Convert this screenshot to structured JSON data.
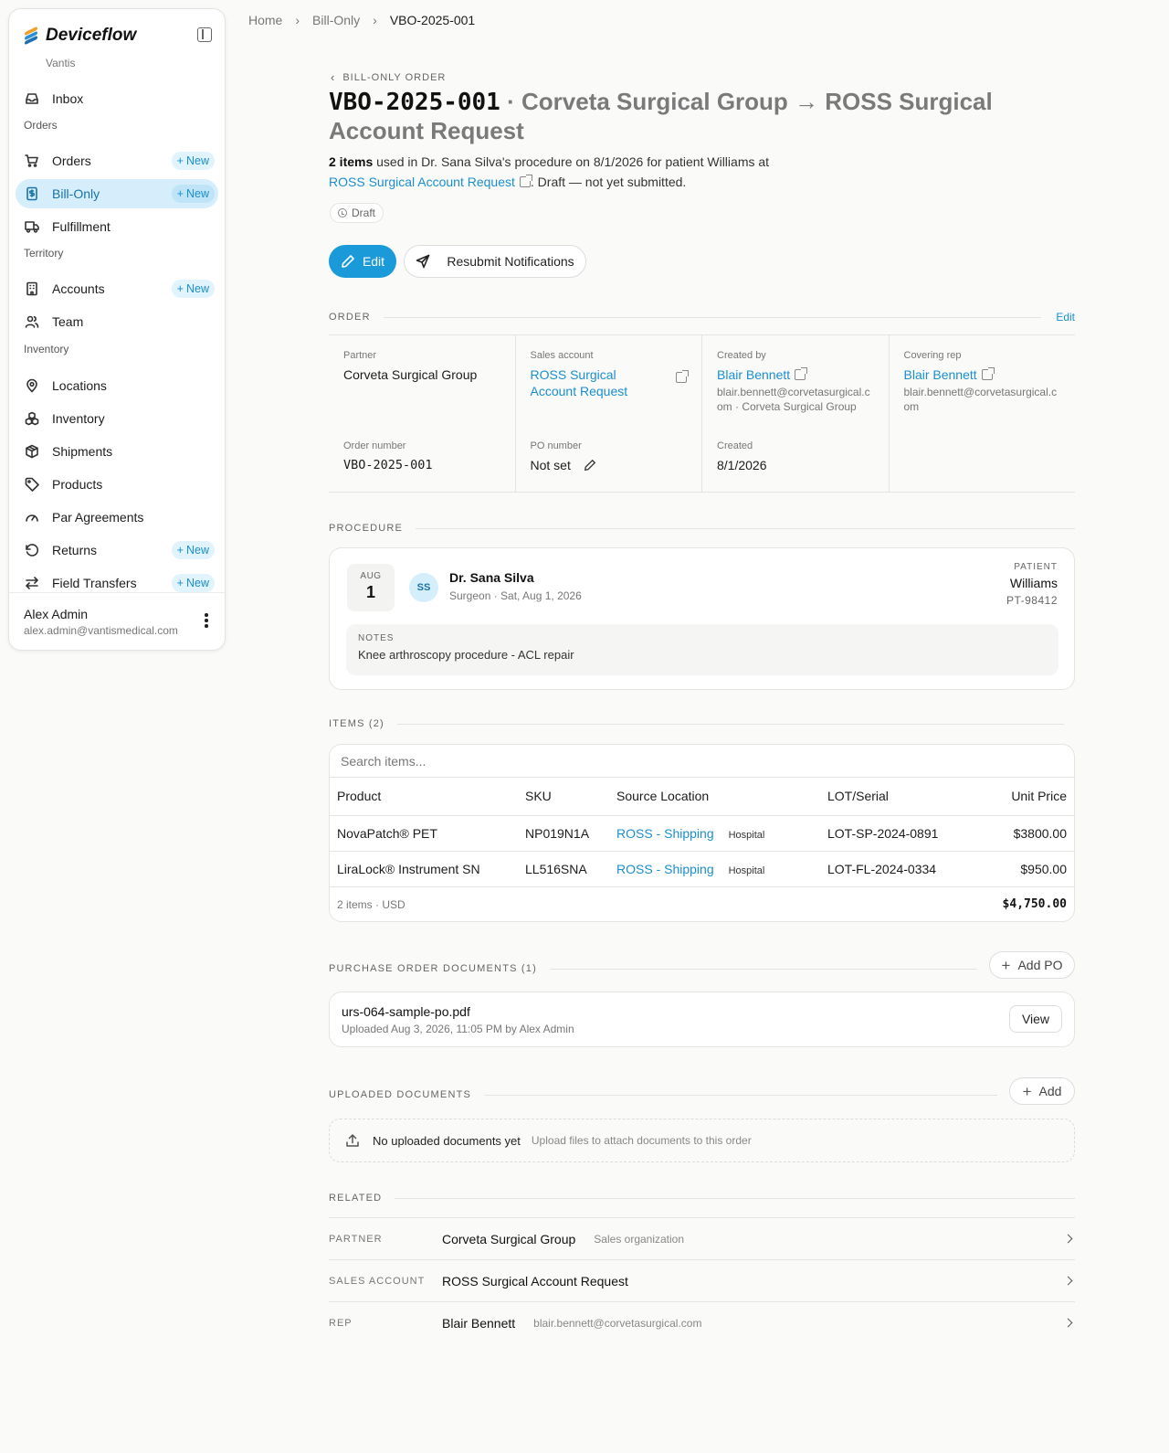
{
  "brand": {
    "name": "Deviceflow",
    "org": "Vantis"
  },
  "nav": {
    "inbox": "Inbox",
    "section_orders": "Orders",
    "orders": "Orders",
    "bill_only": "Bill-Only",
    "fulfillment": "Fulfillment",
    "section_territory": "Territory",
    "accounts": "Accounts",
    "team": "Team",
    "section_inventory": "Inventory",
    "locations": "Locations",
    "inventory": "Inventory",
    "shipments": "Shipments",
    "products": "Products",
    "par_agreements": "Par Agreements",
    "returns": "Returns",
    "field_transfers": "Field Transfers",
    "new_label": "New"
  },
  "user": {
    "name": "Alex Admin",
    "email": "alex.admin@vantismedical.com"
  },
  "breadcrumb": {
    "home": "Home",
    "section": "Bill-Only",
    "current": "VBO-2025-001"
  },
  "header": {
    "back_label": "BILL-ONLY ORDER",
    "order_code": "VBO-2025-001",
    "title_rest": "· Corveta Surgical Group → ROSS Surgical Account Request",
    "summary_count": "2 items",
    "summary_text": " used in Dr. Sana Silva's procedure on 8/1/2026 for patient Williams at",
    "summary_account": "ROSS Surgical Account Request",
    "summary_tail": ". Draft — not yet submitted.",
    "status": "Draft",
    "edit_button": "Edit",
    "resubmit_button": "Resubmit Notifications"
  },
  "order_section": {
    "heading": "ORDER",
    "edit_link": "Edit",
    "partner_label": "Partner",
    "partner_value": "Corveta Surgical Group",
    "sales_account_label": "Sales account",
    "sales_account_value": "ROSS Surgical Account Request",
    "created_by_label": "Created by",
    "created_by_value": "Blair Bennett",
    "created_by_sub": "blair.bennett@corvetasurgical.com · Corveta Surgical Group",
    "covering_rep_label": "Covering rep",
    "covering_rep_value": "Blair Bennett",
    "covering_rep_sub": "blair.bennett@corvetasurgical.com",
    "order_number_label": "Order number",
    "order_number_value": "VBO-2025-001",
    "po_number_label": "PO number",
    "po_number_value": "Not set",
    "created_label": "Created",
    "created_value": "8/1/2026"
  },
  "procedure": {
    "heading": "PROCEDURE",
    "month": "AUG",
    "day": "1",
    "initials": "SS",
    "surgeon": "Dr. Sana Silva",
    "surgeon_sub": "Surgeon · Sat, Aug 1, 2026",
    "patient_label": "PATIENT",
    "patient_name": "Williams",
    "patient_id": "PT-98412",
    "notes_label": "NOTES",
    "notes_text": "Knee arthroscopy procedure - ACL repair"
  },
  "items": {
    "heading": "ITEMS (2)",
    "search_placeholder": "Search items...",
    "columns": {
      "product": "Product",
      "sku": "SKU",
      "source": "Source Location",
      "lot": "LOT/Serial",
      "price": "Unit Price"
    },
    "rows": [
      {
        "product": "NovaPatch® PET",
        "sku": "NP019N1A",
        "source": "ROSS - Shipping",
        "tag": "Hospital",
        "lot": "LOT-SP-2024-0891",
        "price": "$3800.00"
      },
      {
        "product": "LiraLock® Instrument SN",
        "sku": "LL516SNA",
        "source": "ROSS - Shipping",
        "tag": "Hospital",
        "lot": "LOT-FL-2024-0334",
        "price": "$950.00"
      }
    ],
    "footer_count": "2 items · USD",
    "footer_total": "$4,750.00"
  },
  "po_docs": {
    "heading": "PURCHASE ORDER DOCUMENTS (1)",
    "add_button": "Add PO",
    "file_name": "urs-064-sample-po.pdf",
    "file_sub": "Uploaded Aug 3, 2026, 11:05 PM by Alex Admin",
    "view_button": "View"
  },
  "uploaded_docs": {
    "heading": "UPLOADED DOCUMENTS",
    "add_button": "Add",
    "empty_title": "No uploaded documents yet",
    "empty_sub": "Upload files to attach documents to this order"
  },
  "related": {
    "heading": "RELATED",
    "partner_key": "PARTNER",
    "partner_value": "Corveta Surgical Group",
    "partner_sub": "Sales organization",
    "account_key": "SALES ACCOUNT",
    "account_value": "ROSS Surgical Account Request",
    "rep_key": "REP",
    "rep_value": "Blair Bennett",
    "rep_sub": "blair.bennett@corvetasurgical.com"
  },
  "colors": {
    "accent": "#1b9ad9",
    "link": "#1a8fd0",
    "active_nav_bg": "#d6eefb"
  }
}
